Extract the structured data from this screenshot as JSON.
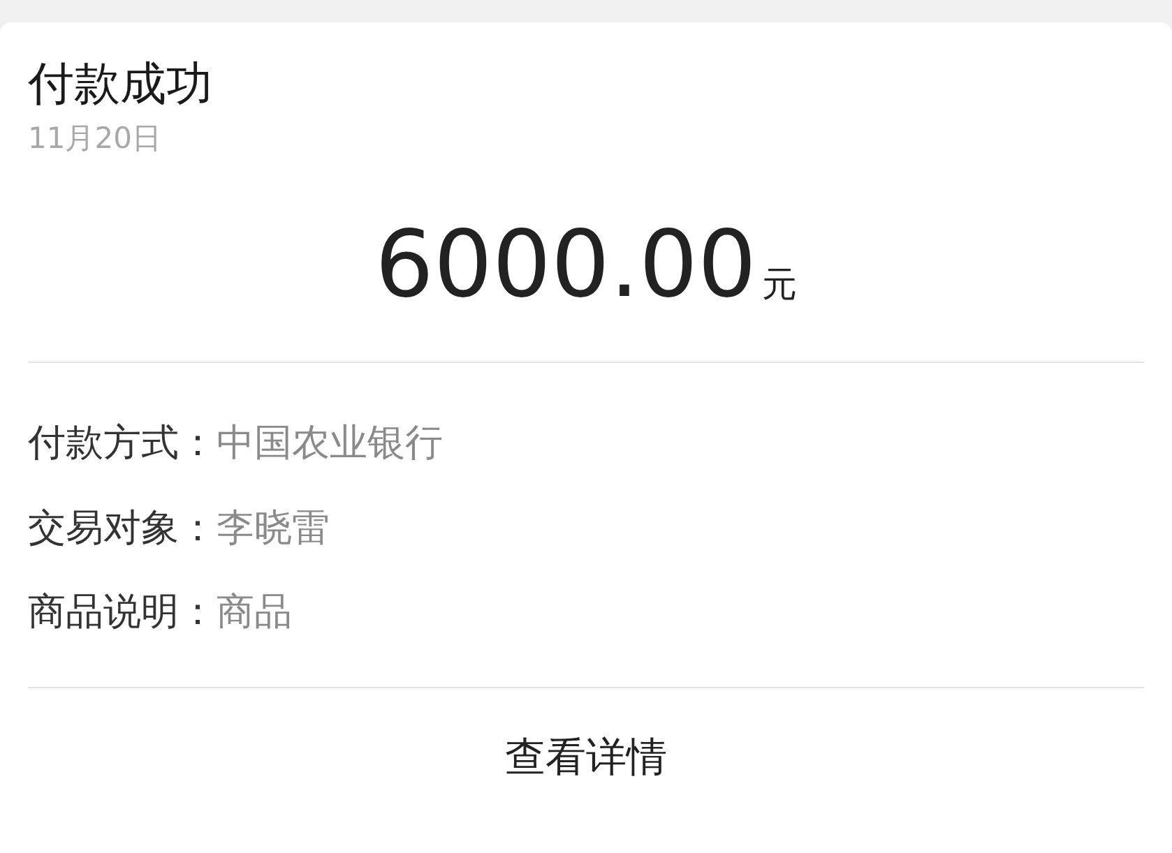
{
  "title": "付款成功",
  "date": "11月20日",
  "amount": {
    "value": "6000.00",
    "unit": "元"
  },
  "details": [
    {
      "label": "付款方式：",
      "value": "中国农业银行"
    },
    {
      "label": "交易对象：",
      "value": "李晓雷"
    },
    {
      "label": "商品说明：",
      "value": "商品"
    }
  ],
  "action": "查看详情"
}
